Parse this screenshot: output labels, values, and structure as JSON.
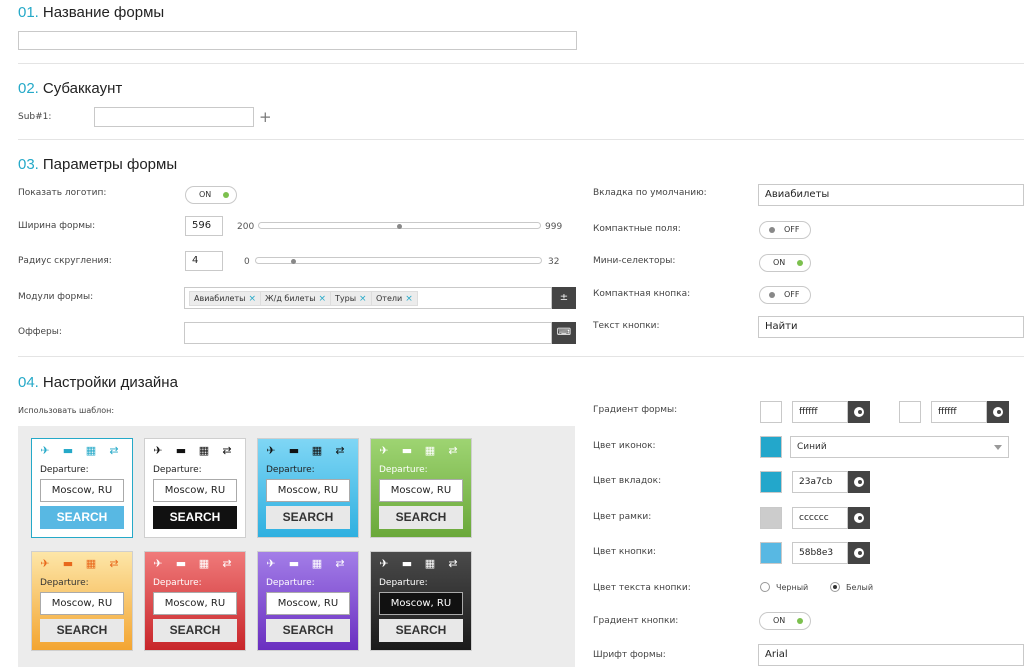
{
  "sections": {
    "s1": {
      "num": "01.",
      "title": "Название формы"
    },
    "s2": {
      "num": "02.",
      "title": "Субаккаунт"
    },
    "s3": {
      "num": "03.",
      "title": "Параметры формы"
    },
    "s4": {
      "num": "04.",
      "title": "Настройки дизайна"
    }
  },
  "form_name": {
    "value": ""
  },
  "subaccount": {
    "label": "Sub#1:",
    "value": "",
    "add": "+"
  },
  "params": {
    "show_logo": {
      "label": "Показать логотип:",
      "state": "ON"
    },
    "width": {
      "label": "Ширина формы:",
      "value": "596",
      "min": "200",
      "max": "999",
      "fraction": 0.5
    },
    "radius": {
      "label": "Радиус скругления:",
      "value": "4",
      "min": "0",
      "max": "32",
      "fraction": 0.125
    },
    "modules": {
      "label": "Модули формы:",
      "tags": [
        "Авиабилеты",
        "Ж/д билеты",
        "Туры",
        "Отели"
      ],
      "btn": "±"
    },
    "offers": {
      "label": "Офферы:",
      "value": ""
    },
    "default_tab": {
      "label": "Вкладка по умолчанию:",
      "value": "Авиабилеты"
    },
    "compact_fields": {
      "label": "Компактные поля:",
      "state": "OFF"
    },
    "mini_selectors": {
      "label": "Мини-селекторы:",
      "state": "ON"
    },
    "compact_button": {
      "label": "Компактная кнопка:",
      "state": "OFF"
    },
    "button_text": {
      "label": "Текст кнопки:",
      "value": "Найти"
    }
  },
  "design": {
    "use_template": "Использовать шаблон:",
    "gradient": {
      "label": "Градиент формы:",
      "hex1": "ffffff",
      "hex2": "ffffff",
      "color1": "#ffffff",
      "color2": "#ffffff"
    },
    "icon_color": {
      "label": "Цвет иконок:",
      "value": "Синий",
      "color": "#23a7cb"
    },
    "tab_color": {
      "label": "Цвет вкладок:",
      "hex": "23a7cb",
      "color": "#23a7cb"
    },
    "border_color": {
      "label": "Цвет рамки:",
      "hex": "cccccc",
      "color": "#cccccc"
    },
    "button_color": {
      "label": "Цвет кнопки:",
      "hex": "58b8e3",
      "color": "#58b8e3"
    },
    "button_text_color": {
      "label": "Цвет текста кнопки:",
      "options": [
        "Черный",
        "Белый"
      ],
      "selected": "Белый"
    },
    "button_gradient": {
      "label": "Градиент кнопки:",
      "state": "ON"
    },
    "font": {
      "label": "Шрифт формы:",
      "value": "Arial"
    }
  },
  "templates": [
    {
      "departure": "Departure:",
      "city": "Moscow, RU",
      "button": "SEARCH"
    },
    {
      "departure": "Departure:",
      "city": "Moscow, RU",
      "button": "SEARCH"
    },
    {
      "departure": "Departure:",
      "city": "Moscow, RU",
      "button": "SEARCH"
    },
    {
      "departure": "Departure:",
      "city": "Moscow, RU",
      "button": "SEARCH"
    },
    {
      "departure": "Departure:",
      "city": "Moscow, RU",
      "button": "SEARCH"
    },
    {
      "departure": "Departure:",
      "city": "Moscow, RU",
      "button": "SEARCH"
    },
    {
      "departure": "Departure:",
      "city": "Moscow, RU",
      "button": "SEARCH"
    },
    {
      "departure": "Departure:",
      "city": "Moscow, RU",
      "button": "SEARCH"
    }
  ],
  "icons": [
    "plane-icon",
    "bed-icon",
    "calendar-icon",
    "swap-icon"
  ]
}
